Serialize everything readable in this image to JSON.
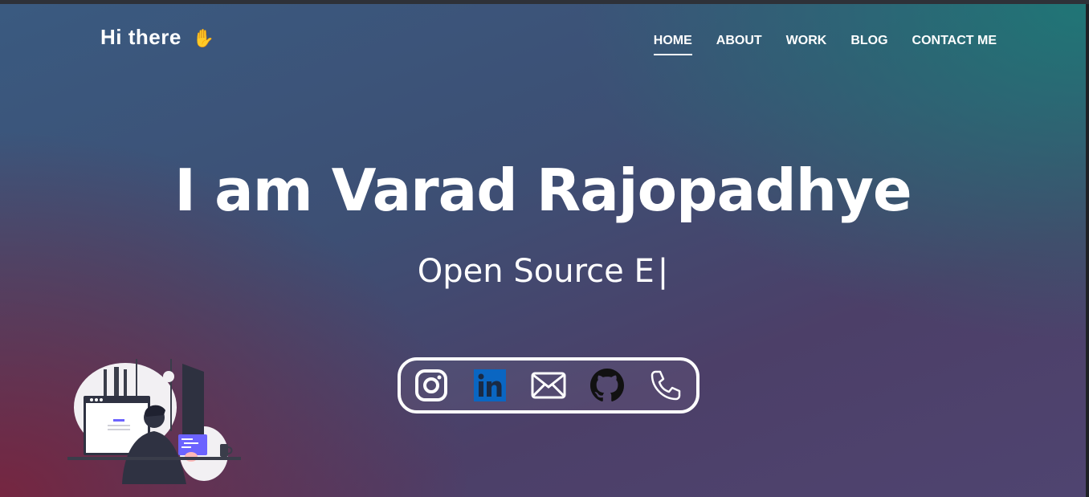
{
  "header": {
    "brand": "Hi there",
    "brand_emoji": "✋",
    "nav": [
      {
        "label": "HOME",
        "active": true
      },
      {
        "label": "ABOUT",
        "active": false
      },
      {
        "label": "WORK",
        "active": false
      },
      {
        "label": "BLOG",
        "active": false
      },
      {
        "label": "CONTACT ME",
        "active": false
      }
    ]
  },
  "hero": {
    "title": "I am Varad Rajopadhye",
    "subtitle": "Open Source E",
    "cursor": "|"
  },
  "social": {
    "icons": [
      "instagram-icon",
      "linkedin-icon",
      "email-icon",
      "github-icon",
      "phone-icon"
    ],
    "linkedin_color": "#0a66c2"
  },
  "illustration": {
    "icon": "developer-at-desk-illustration"
  }
}
